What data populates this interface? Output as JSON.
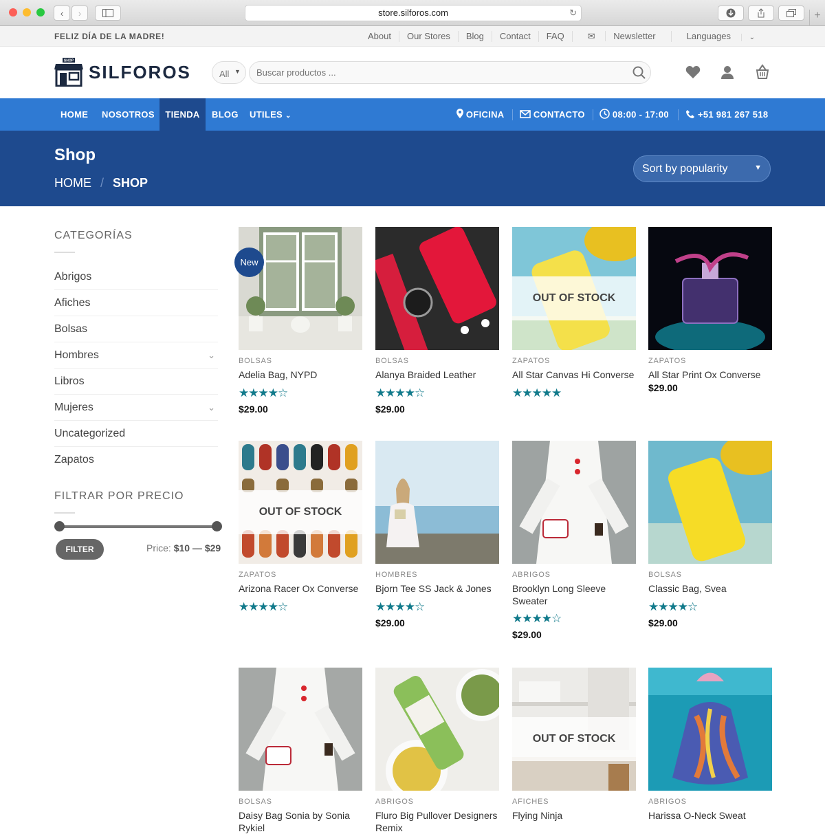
{
  "browser": {
    "url": "store.silforos.com"
  },
  "topbar": {
    "promo": "FELIZ DÍA DE LA MADRE!",
    "links": [
      "About",
      "Our Stores",
      "Blog",
      "Contact",
      "FAQ",
      "Newsletter",
      "Languages"
    ]
  },
  "header": {
    "logo": "SILFOROS",
    "logo_sign": "SHOP",
    "category_select": "All",
    "search_placeholder": "Buscar productos ..."
  },
  "nav": {
    "items": [
      "HOME",
      "NOSOTROS",
      "TIENDA",
      "BLOG",
      "UTILES"
    ],
    "active": "TIENDA",
    "info": [
      "OFICINA",
      "CONTACTO",
      "08:00 - 17:00",
      "+51 981 267 518"
    ]
  },
  "page": {
    "title": "Shop",
    "breadcrumb": [
      "HOME",
      "SHOP"
    ],
    "sort": "Sort by popularity"
  },
  "sidebar": {
    "categories_title": "CATEGORÍAS",
    "categories": [
      "Abrigos",
      "Afiches",
      "Bolsas",
      "Hombres",
      "Libros",
      "Mujeres",
      "Uncategorized",
      "Zapatos"
    ],
    "filter_title": "FILTRAR POR PRECIO",
    "filter_button": "FILTER",
    "price_label": "Price:",
    "price_range": "$10 — $29"
  },
  "badges": {
    "new": "New",
    "out_of_stock": "OUT OF STOCK"
  },
  "products": [
    {
      "category": "BOLSAS",
      "name": "Adelia Bag, NYPD",
      "rating": 4,
      "price": "$29.00",
      "badge": "New",
      "out_of_stock": false
    },
    {
      "category": "BOLSAS",
      "name": "Alanya Braided Leather",
      "rating": 4,
      "price": "$29.00",
      "out_of_stock": false
    },
    {
      "category": "ZAPATOS",
      "name": "All Star Canvas Hi Converse",
      "rating": 5,
      "price": "",
      "out_of_stock": true
    },
    {
      "category": "ZAPATOS",
      "name": "All Star Print Ox Converse",
      "rating": 0,
      "price": "$29.00",
      "out_of_stock": false
    },
    {
      "category": "ZAPATOS",
      "name": "Arizona Racer Ox Converse",
      "rating": 4,
      "price": "",
      "out_of_stock": true
    },
    {
      "category": "HOMBRES",
      "name": "Bjorn Tee SS Jack & Jones",
      "rating": 4,
      "price": "$29.00",
      "out_of_stock": false
    },
    {
      "category": "ABRIGOS",
      "name": "Brooklyn Long Sleeve Sweater",
      "rating": 4,
      "price": "$29.00",
      "out_of_stock": false
    },
    {
      "category": "BOLSAS",
      "name": "Classic Bag, Svea",
      "rating": 4,
      "price": "$29.00",
      "out_of_stock": false
    },
    {
      "category": "BOLSAS",
      "name": "Daisy Bag Sonia by Sonia Rykiel",
      "rating": 0,
      "price": "",
      "out_of_stock": false
    },
    {
      "category": "ABRIGOS",
      "name": "Fluro Big Pullover Designers Remix",
      "rating": 0,
      "price": "",
      "out_of_stock": false
    },
    {
      "category": "AFICHES",
      "name": "Flying Ninja",
      "rating": 0,
      "price": "",
      "out_of_stock": true
    },
    {
      "category": "ABRIGOS",
      "name": "Harissa O-Neck Sweat",
      "rating": 0,
      "price": "",
      "out_of_stock": false
    }
  ]
}
